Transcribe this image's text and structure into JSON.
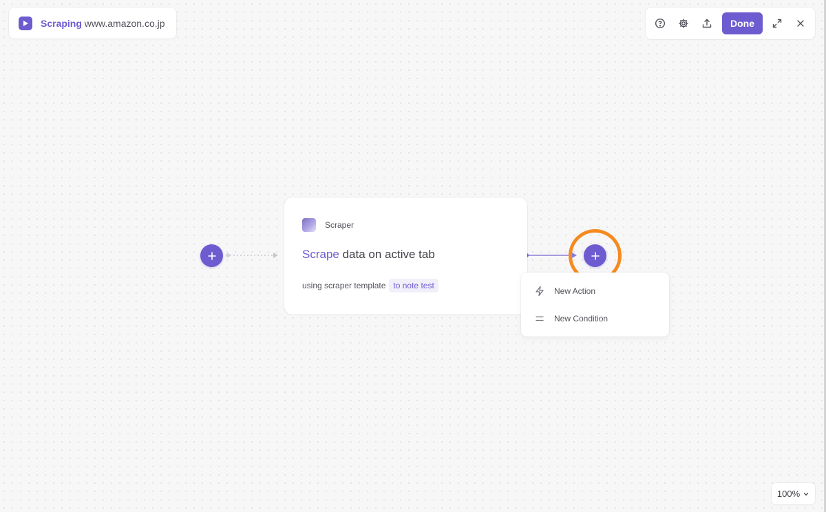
{
  "header": {
    "title_accent": "Scraping",
    "title_host": "www.amazon.co.jp"
  },
  "toolbar": {
    "done_label": "Done",
    "icons": [
      "help-circle-icon",
      "gear-icon",
      "upload-icon",
      "expand-icon",
      "close-icon"
    ]
  },
  "node": {
    "type_label": "Scraper",
    "title_verb": "Scrape",
    "title_rest": " data on active tab",
    "meta_prefix": "using scraper template",
    "template_tag": "to note test"
  },
  "menu": {
    "items": [
      {
        "label": "New Action",
        "icon": "lightning-icon"
      },
      {
        "label": "New Condition",
        "icon": "equals-icon"
      }
    ]
  },
  "zoom": {
    "level": "100%"
  },
  "colors": {
    "accent": "#6d5bd0",
    "highlight": "#f68a1f",
    "background": "#f7f7f8"
  }
}
